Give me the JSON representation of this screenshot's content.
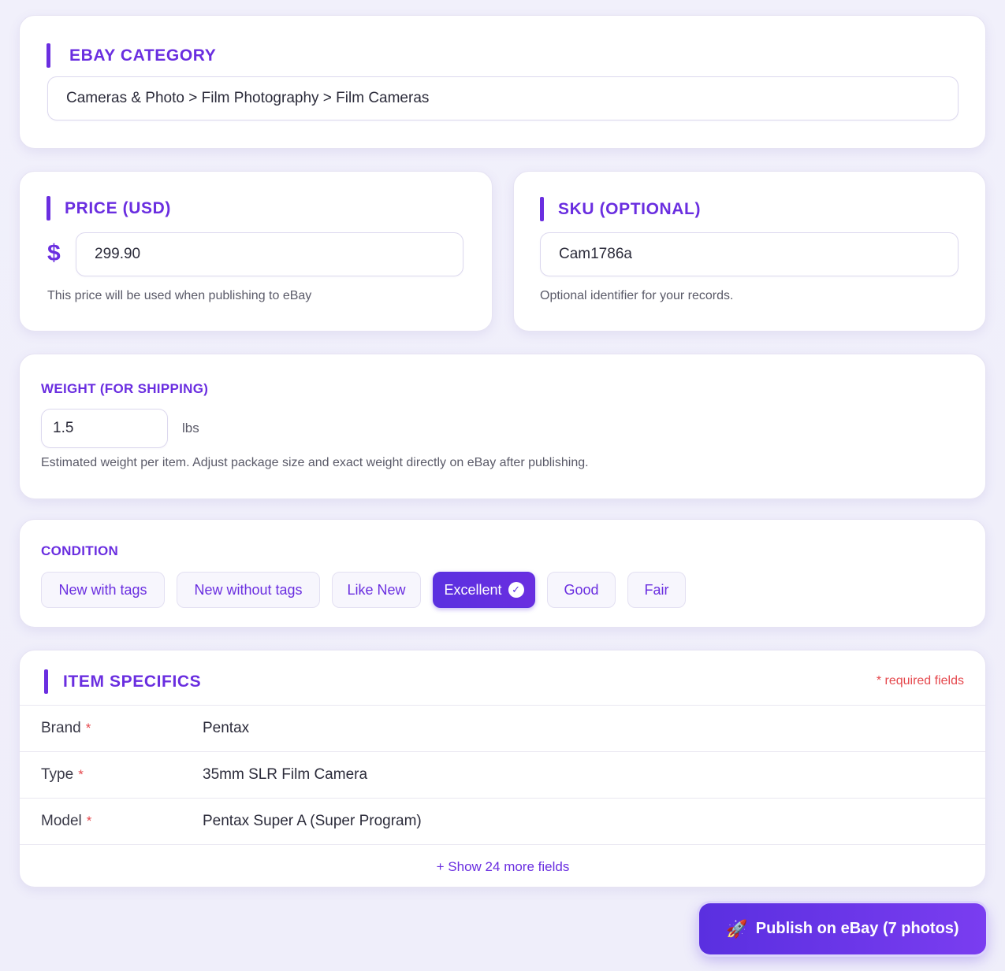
{
  "category": {
    "title": "EBAY CATEGORY",
    "value": "Cameras & Photo > Film Photography > Film Cameras"
  },
  "price": {
    "title": "PRICE (USD)",
    "currency_symbol": "$",
    "value": "299.90",
    "help": "This price will be used when publishing to eBay"
  },
  "sku": {
    "title": "SKU (OPTIONAL)",
    "value": "Cam1786a",
    "help": "Optional identifier for your records."
  },
  "weight": {
    "title": "WEIGHT (FOR SHIPPING)",
    "value": "1.5",
    "unit": "lbs",
    "help": "Estimated weight per item. Adjust package size and exact weight directly on eBay after publishing."
  },
  "condition": {
    "title": "CONDITION",
    "options": [
      "New with tags",
      "New without tags",
      "Like New",
      "Excellent",
      "Good",
      "Fair"
    ],
    "selected": "Excellent"
  },
  "specifics": {
    "title": "ITEM SPECIFICS",
    "required_note": "* required fields",
    "required_marker": "*",
    "rows": [
      {
        "label": "Brand",
        "value": "Pentax"
      },
      {
        "label": "Type",
        "value": "35mm SLR Film Camera"
      },
      {
        "label": "Model",
        "value": "Pentax Super A (Super Program)"
      }
    ],
    "show_more": "+ Show 24 more fields"
  },
  "publish": {
    "icon": "rocket-icon",
    "label": "Publish on eBay (7 photos)"
  },
  "colors": {
    "accent": "#6a2ee0",
    "required": "#e5484d"
  }
}
